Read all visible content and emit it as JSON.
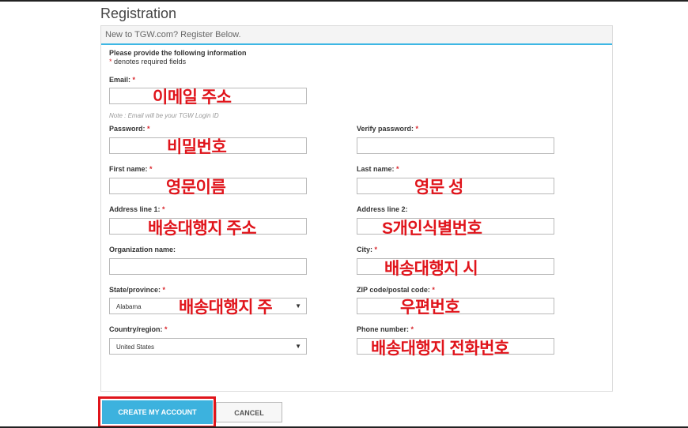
{
  "page_title": "Registration",
  "panel_header": "New to TGW.com? Register Below.",
  "intro": {
    "heading": "Please provide the following information",
    "required_mark": "*",
    "required_note": " denotes required fields"
  },
  "fields": {
    "email": {
      "label": "Email:",
      "req": "*",
      "value": ""
    },
    "email_note": "Note : Email will be your TGW Login ID",
    "password": {
      "label": "Password:",
      "req": "*",
      "value": ""
    },
    "verify_password": {
      "label": "Verify password:",
      "req": "*",
      "value": ""
    },
    "first_name": {
      "label": "First name:",
      "req": "*",
      "value": ""
    },
    "last_name": {
      "label": "Last name:",
      "req": "*",
      "value": ""
    },
    "address1": {
      "label": "Address line 1:",
      "req": "*",
      "value": ""
    },
    "address2": {
      "label": "Address line 2:",
      "value": ""
    },
    "organization": {
      "label": "Organization name:",
      "value": ""
    },
    "city": {
      "label": "City:",
      "req": "*",
      "value": ""
    },
    "state": {
      "label": "State/province:",
      "req": "*",
      "selected": "Alabama"
    },
    "zip": {
      "label": "ZIP code/postal code:",
      "req": "*",
      "value": ""
    },
    "country": {
      "label": "Country/region:",
      "req": "*",
      "selected": "United States"
    },
    "phone": {
      "label": "Phone number:",
      "req": "*",
      "value": ""
    }
  },
  "annotations": {
    "email": "이메일 주소",
    "password": "비밀번호",
    "first_name": "영문이름",
    "last_name": "영문 성",
    "address1": "배송대행지 주소",
    "address2": "S개인식별번호",
    "city": "배송대행지 시",
    "state": "배송대행지 주",
    "zip": "우편번호",
    "phone": "배송대행지 전화번호"
  },
  "buttons": {
    "create": "CREATE MY ACCOUNT",
    "cancel": "CANCEL"
  },
  "icons": {
    "dropdown": "chevron-down-icon"
  },
  "colors": {
    "accent": "#3cb2de",
    "required": "#d9262c",
    "annotation": "#e0141b"
  }
}
